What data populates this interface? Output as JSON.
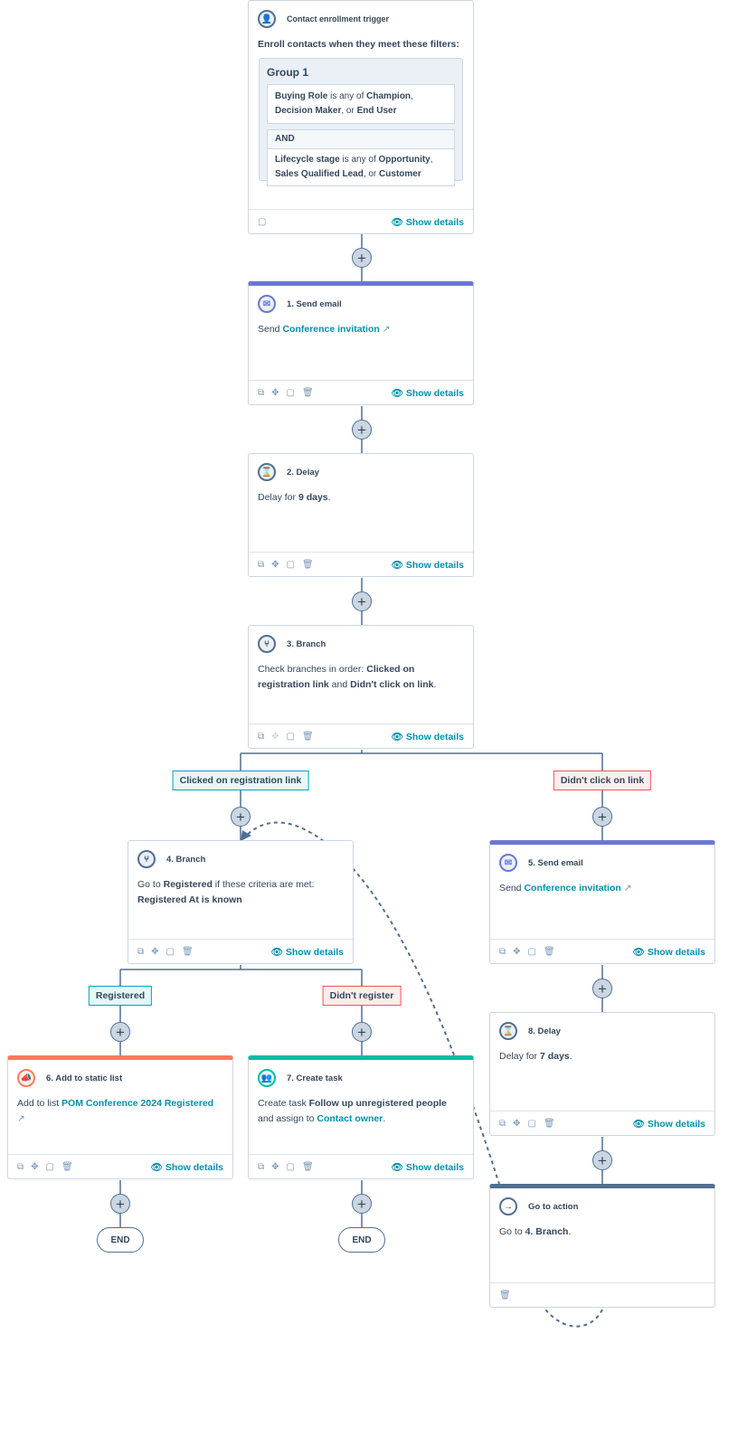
{
  "colors": {
    "email": "#6a78d1",
    "list": "#ff7a59",
    "task": "#00bda5",
    "goto": "#516f90",
    "link": "#0091ae"
  },
  "trigger": {
    "title": "Contact enrollment trigger",
    "intro": "Enroll contacts when they meet these filters:",
    "group": "Group 1",
    "f1": {
      "prop": "Buying Role",
      "op": " is any of ",
      "v1": "Champion",
      "v2": "Decision Maker",
      "v3": "End User"
    },
    "and": "AND",
    "f2": {
      "prop": "Lifecycle stage",
      "op": " is any of ",
      "v1": "Opportunity",
      "v2": "Sales Qualified Lead",
      "v3": "Customer"
    }
  },
  "show_details": "Show details",
  "sep_comma": ", ",
  "sep_or": ", or ",
  "a1": {
    "title": "1. Send email",
    "pre": "Send ",
    "link": "Conference invitation"
  },
  "a2": {
    "title": "2. Delay",
    "pre": "Delay for ",
    "val": "9 days",
    "post": "."
  },
  "a3": {
    "title": "3. Branch",
    "pre": "Check branches in order: ",
    "b1": "Clicked on registration link",
    "mid": " and ",
    "b2": "Didn't click on link",
    "post": "."
  },
  "branch3": {
    "left": "Clicked on registration link",
    "right": "Didn't click on link"
  },
  "a4": {
    "title": "4. Branch",
    "pre": "Go to ",
    "b": "Registered",
    "mid": " if these criteria are met:",
    "crit": "Registered At is known"
  },
  "branch4": {
    "left": "Registered",
    "right": "Didn't register"
  },
  "a5": {
    "title": "5. Send email",
    "pre": "Send ",
    "link": "Conference invitation"
  },
  "a6": {
    "title": "6. Add to static list",
    "pre": "Add to list ",
    "link": "POM Conference 2024 Registered"
  },
  "a7": {
    "title": "7. Create task",
    "pre": "Create task ",
    "task": "Follow up unregistered people",
    "mid": " and assign to ",
    "owner": "Contact owner",
    "post": "."
  },
  "a8": {
    "title": "8. Delay",
    "pre": "Delay for ",
    "val": "7 days",
    "post": "."
  },
  "a9": {
    "title": "Go to action",
    "pre": "Go to ",
    "target": "4. Branch",
    "post": "."
  },
  "end": "END"
}
